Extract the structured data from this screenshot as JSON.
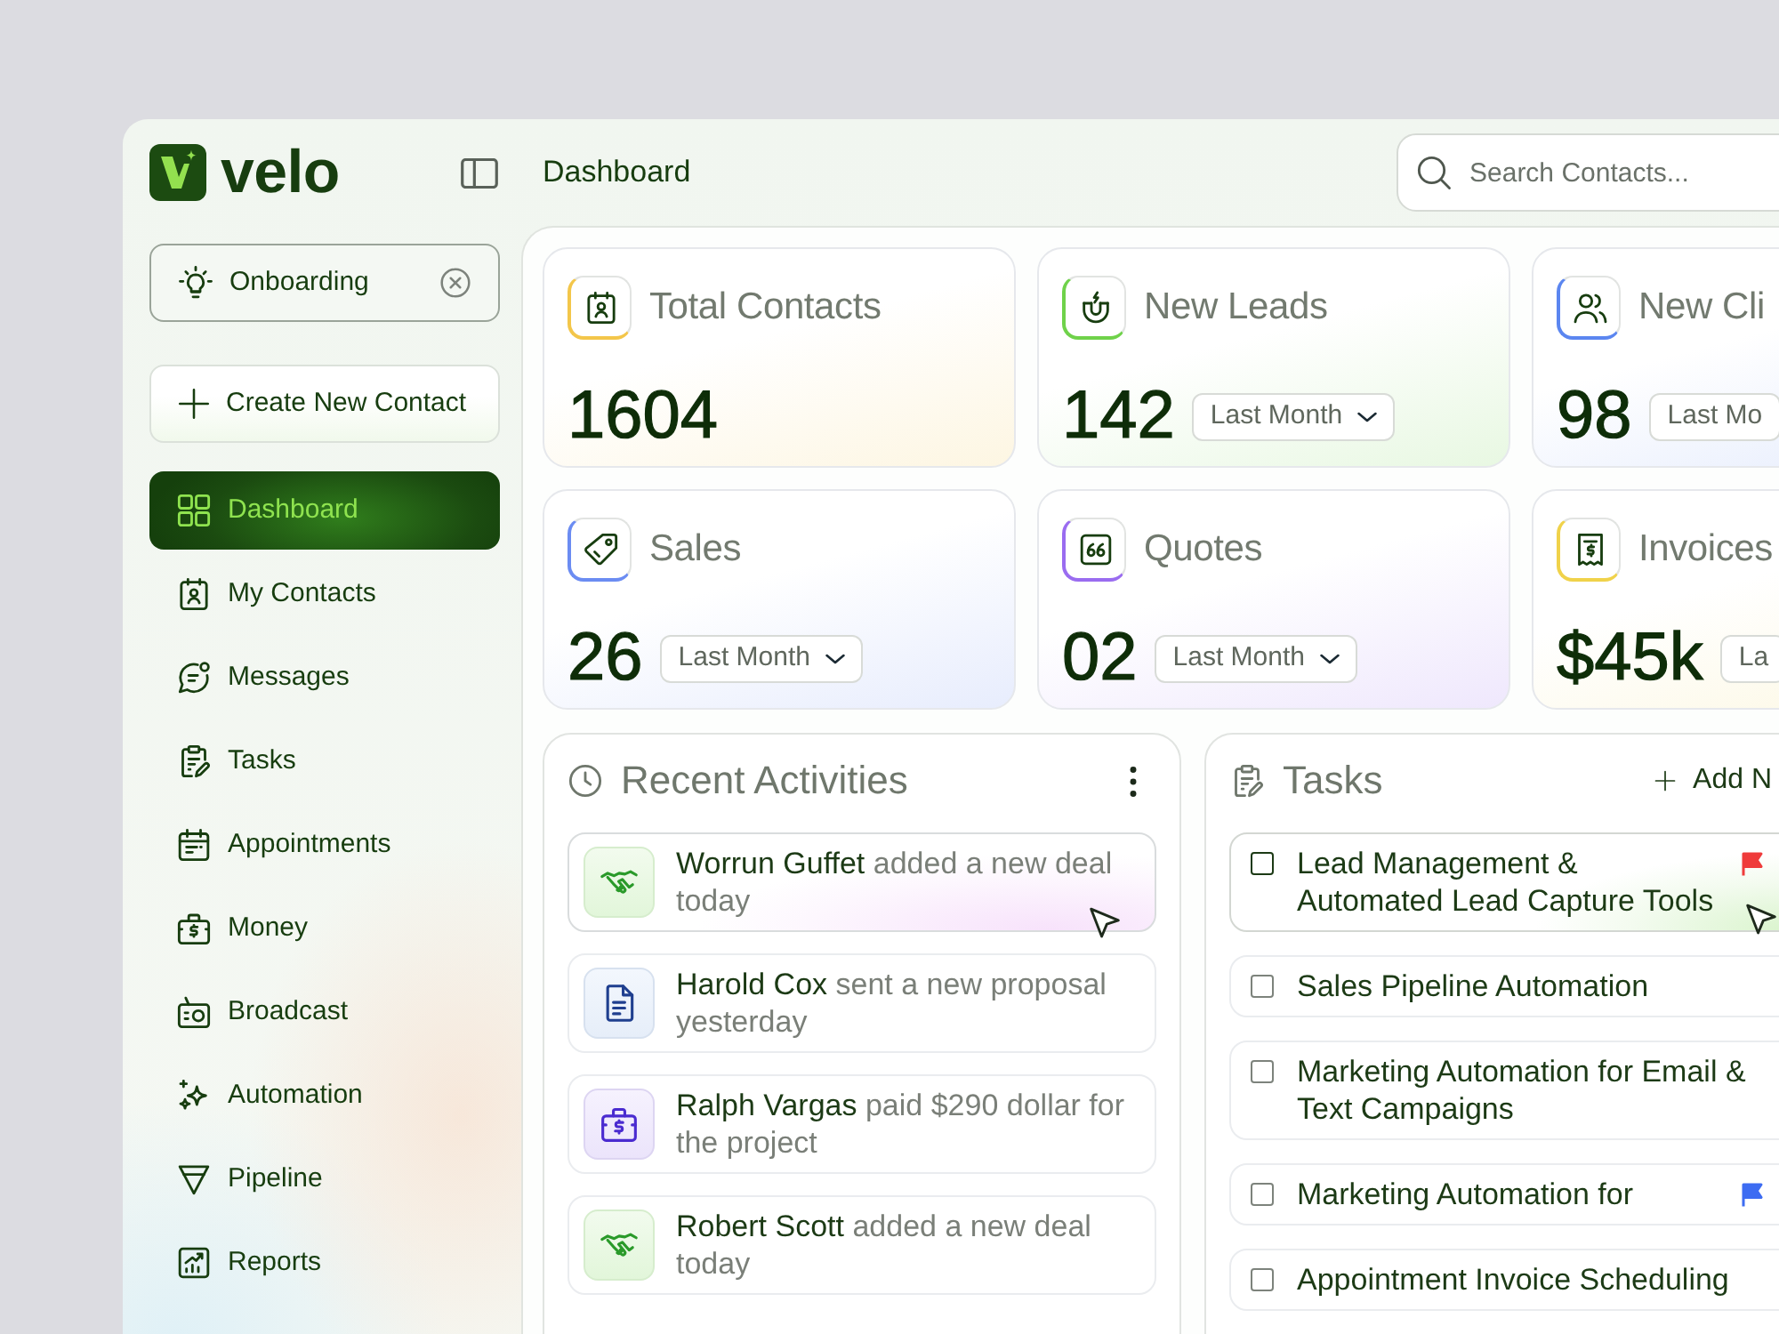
{
  "header": {
    "logo_text": "velo",
    "page_title": "Dashboard",
    "search": {
      "placeholder": "Search Contacts..."
    }
  },
  "sidebar": {
    "onboarding": "Onboarding",
    "create_button": "Create New Contact",
    "items": [
      {
        "label": "Dashboard",
        "selected": true
      },
      {
        "label": "My Contacts",
        "selected": false
      },
      {
        "label": "Messages",
        "selected": false
      },
      {
        "label": "Tasks",
        "selected": false
      },
      {
        "label": "Appointments",
        "selected": false
      },
      {
        "label": "Money",
        "selected": false
      },
      {
        "label": "Broadcast",
        "selected": false
      },
      {
        "label": "Automation",
        "selected": false
      },
      {
        "label": "Pipeline",
        "selected": false
      },
      {
        "label": "Reports",
        "selected": false
      }
    ]
  },
  "stats": [
    {
      "title": "Total Contacts",
      "value": "1604",
      "color": "#f3c64a"
    },
    {
      "title": "New Leads",
      "value": "142",
      "period": "Last Month",
      "color": "#6fd24a"
    },
    {
      "title": "New Cli",
      "value": "98",
      "period": "Last Mo",
      "color": "#5b86f0"
    },
    {
      "title": "Sales",
      "value": "26",
      "period": "Last Month",
      "color": "#6b8cf2"
    },
    {
      "title": "Quotes",
      "value": "02",
      "period": "Last Month",
      "color": "#9a6cf0"
    },
    {
      "title": "Invoices",
      "value": "$45k",
      "period": "La",
      "color": "#f0d24a"
    }
  ],
  "recent_activities": {
    "title": "Recent Activities",
    "items": [
      {
        "kind": "deal",
        "name": "Worrun Guffet",
        "action": "added a new deal today",
        "hovered": true
      },
      {
        "kind": "proposal",
        "name": "Harold Cox",
        "action": "sent a new proposal yesterday",
        "hovered": false
      },
      {
        "kind": "payment",
        "name": "Ralph Vargas",
        "action": "paid $290 dollar for the project",
        "hovered": false
      },
      {
        "kind": "deal",
        "name": "Robert Scott",
        "action": "added a new deal today",
        "hovered": false
      }
    ]
  },
  "tasks": {
    "title": "Tasks",
    "add_button": "Add N",
    "items": [
      {
        "title": "Lead Management & Automated Lead Capture Tools",
        "checked": false,
        "hovered": true,
        "color": "#ef3b3b"
      },
      {
        "title": "Sales Pipeline Automation",
        "checked": false,
        "hovered": false
      },
      {
        "title": "Marketing Automation for Email & Text Campaigns",
        "checked": false,
        "hovered": false
      },
      {
        "title": "Marketing Automation for",
        "checked": false,
        "hovered": false,
        "color": "#3d6cf2"
      },
      {
        "title": "Appointment Invoice Scheduling",
        "checked": false,
        "hovered": false
      }
    ]
  }
}
